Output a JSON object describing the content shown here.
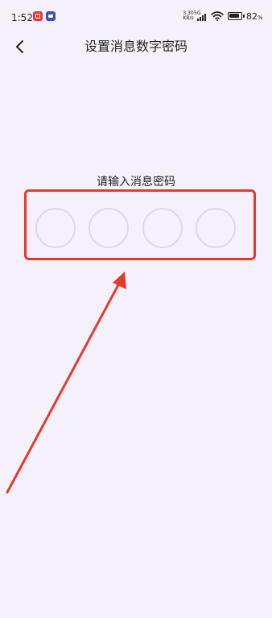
{
  "status_bar": {
    "time": "1:52",
    "net_speed_value": "3.30",
    "net_speed_unit": "KB/s",
    "network_type": "5G",
    "battery_level": "82",
    "battery_unit": "%",
    "icons": [
      "notification-app-icon",
      "notification-app-icon",
      "signal-icon",
      "wifi-icon",
      "battery-icon"
    ]
  },
  "header": {
    "title": "设置消息数字密码",
    "back_icon": "chevron-left-icon"
  },
  "main": {
    "prompt": "请输入消息密码",
    "pin_length": 4
  },
  "annotation": {
    "color": "#e23b2e",
    "shapes": [
      "highlight-box",
      "arrow"
    ]
  },
  "colors": {
    "background": "#f4f1fa",
    "pin_border": "#dcd9e2",
    "annotation": "#e23b2e"
  }
}
